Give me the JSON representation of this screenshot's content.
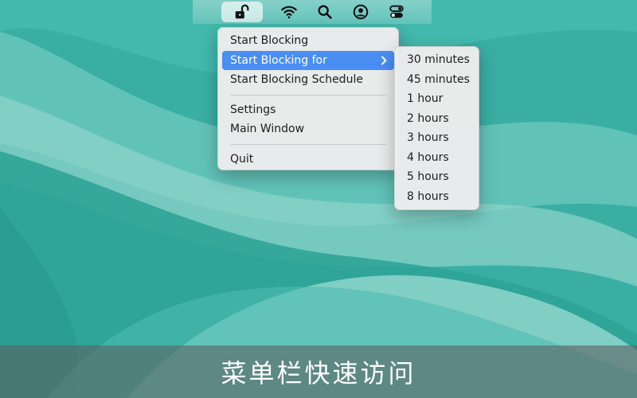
{
  "menubar": {
    "icons": [
      "lock-open-icon",
      "wifi-icon",
      "search-icon",
      "user-icon",
      "control-center-icon"
    ]
  },
  "main_menu": {
    "items": [
      {
        "label": "Start Blocking"
      },
      {
        "label": "Start Blocking for",
        "has_submenu": true,
        "selected": true
      },
      {
        "label": "Start Blocking Schedule"
      },
      {
        "label": "Settings"
      },
      {
        "label": "Main Window"
      },
      {
        "label": "Quit"
      }
    ]
  },
  "submenu": {
    "items": [
      "30 minutes",
      "45 minutes",
      "1 hour",
      "2 hours",
      "3 hours",
      "4 hours",
      "5 hours",
      "8 hours"
    ]
  },
  "caption": "菜单栏快速访问",
  "colors": {
    "wallpaper": "#3bb1a6",
    "highlight": "#4a8ef4",
    "menu_bg": "#ececec"
  }
}
